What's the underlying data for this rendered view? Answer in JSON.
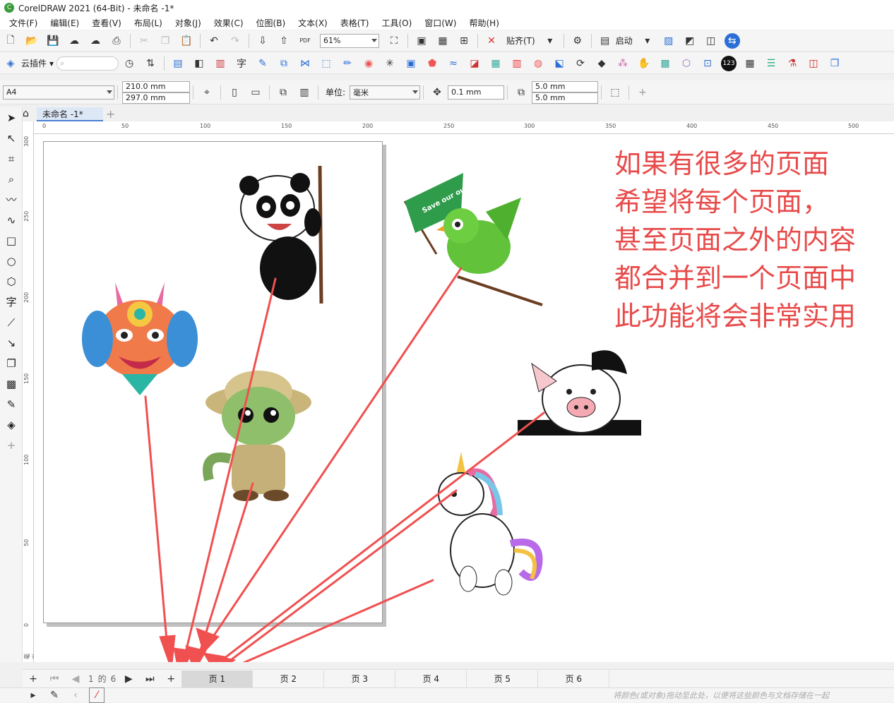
{
  "window": {
    "title": "CorelDRAW 2021 (64-Bit) - 未命名 -1*"
  },
  "menu": [
    "文件(F)",
    "编辑(E)",
    "查看(V)",
    "布局(L)",
    "对象(J)",
    "效果(C)",
    "位图(B)",
    "文本(X)",
    "表格(T)",
    "工具(O)",
    "窗口(W)",
    "帮助(H)"
  ],
  "standard_toolbar": {
    "zoom": "61%",
    "snap_label": "贴齐(T)",
    "launch_label": "启动"
  },
  "plugin_toolbar": {
    "cloud_plugin_label": "云插件"
  },
  "property_bar": {
    "page_size": "A4",
    "width": "210.0 mm",
    "height": "297.0 mm",
    "unit_label": "单位:",
    "unit": "毫米",
    "nudge": "0.1 mm",
    "dup_x": "5.0 mm",
    "dup_y": "5.0 mm"
  },
  "document_tab": {
    "name": "未命名 -1*"
  },
  "ruler": {
    "h_ticks": [
      "0",
      "50",
      "100",
      "150",
      "200",
      "250",
      "300",
      "350",
      "400",
      "450",
      "500"
    ],
    "v_ticks": [
      "300",
      "250",
      "200",
      "150",
      "100",
      "50",
      "0"
    ],
    "unit_label": "毫米"
  },
  "note": {
    "lines": [
      "如果有很多的页面",
      "希望将每个页面，",
      "甚至页面之外的内容",
      "都合并到一个页面中",
      "此功能将会非常实用"
    ]
  },
  "flag_text": "Save our our planet",
  "page_nav": {
    "current": "1",
    "of_label": "的",
    "total": "6",
    "tabs": [
      "页 1",
      "页 2",
      "页 3",
      "页 4",
      "页 5",
      "页 6"
    ]
  },
  "status": {
    "hint": "将颜色(或对象)拖动至此处，以便将这些颜色与文档存储在一起"
  },
  "colors": {
    "note": "#e84a4a",
    "arrow": "#f05050",
    "title_logo": "#3a9b3a"
  }
}
